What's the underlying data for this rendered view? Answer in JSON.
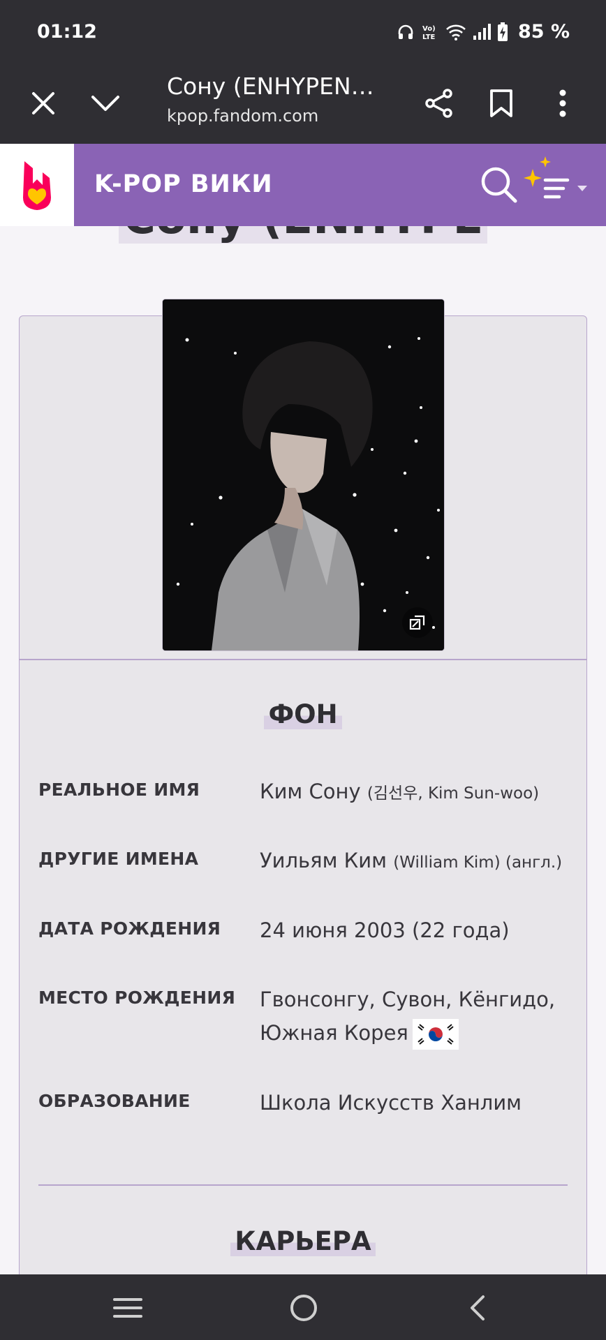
{
  "status_bar": {
    "time": "01:12",
    "battery_percent": "85 %",
    "icons": [
      "headphones-icon",
      "volte-icon",
      "wifi-icon",
      "signal-icon",
      "battery-charging-icon"
    ]
  },
  "browser": {
    "tab_title": "Сону (ENHYPEN…",
    "url": "kpop.fandom.com",
    "buttons": [
      "close-icon",
      "chevron-down-icon",
      "share-icon",
      "bookmark-icon",
      "more-vert-icon"
    ]
  },
  "fandom_header": {
    "wiki_name": "K-POP ВИКИ",
    "logo": "fandom-logo",
    "accent_color": "#8a63b5"
  },
  "page": {
    "title": "Сону (ENHYPEN)"
  },
  "infobox": {
    "section_background": "ФОН",
    "rows": [
      {
        "label": "РЕАЛЬНОЕ ИМЯ",
        "value_main": "Ким Сону",
        "value_small": "(김선우, Kim Sun-woo)"
      },
      {
        "label": "ДРУГИЕ ИМЕНА",
        "value_main": "Уильям Ким",
        "value_small": "(William Kim) (англ.)"
      },
      {
        "label": "ДАТА РОЖДЕНИЯ",
        "value_main": "24 июня 2003 (22 года)",
        "value_small": ""
      },
      {
        "label": "МЕСТО РОЖДЕНИЯ",
        "value_line1": "Гвонсонгу, Сувон, Кёнгидо,",
        "value_line2": "Южная Корея",
        "flag": "south-korea-flag"
      },
      {
        "label": "ОБРАЗОВАНИЕ",
        "value_main": "Школа Искусств Ханлим",
        "value_small": ""
      }
    ],
    "section_career": "КАРЬЕРА"
  },
  "nav_bar": {
    "buttons": [
      "recent-apps-icon",
      "home-icon",
      "back-icon"
    ]
  }
}
